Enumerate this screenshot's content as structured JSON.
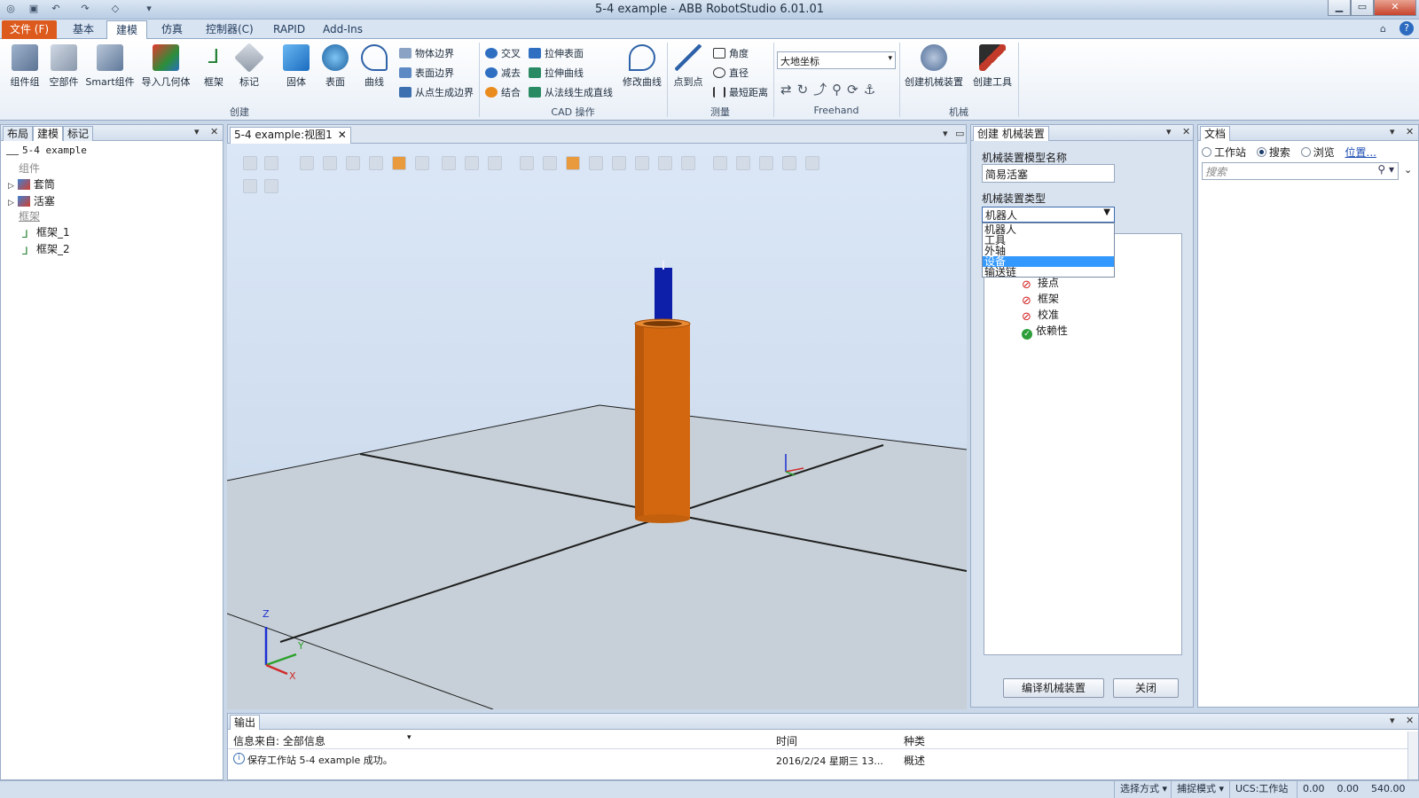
{
  "window": {
    "title": "5-4 example - ABB RobotStudio 6.01.01"
  },
  "menu_tabs": [
    "文件 (F)",
    "基本",
    "建模",
    "仿真",
    "控制器(C)",
    "RAPID",
    "Add-Ins"
  ],
  "ribbon": {
    "create_buttons": [
      "组件组",
      "空部件",
      "Smart组件",
      "导入几何体",
      "框架",
      "标记",
      "固体",
      "表面",
      "曲线"
    ],
    "border_items": [
      "物体边界",
      "表面边界",
      "从点生成边界"
    ],
    "group_create": "创建",
    "cad_items": [
      "交叉",
      "减去",
      "结合",
      "拉伸表面",
      "拉伸曲线",
      "从法线生成直线"
    ],
    "modify_curve": "修改曲线",
    "group_cad": "CAD 操作",
    "point_to_point": "点到点",
    "measure_items": [
      "角度",
      "直径",
      "最短距离"
    ],
    "group_measure": "测量",
    "coord_select": "大地坐标",
    "group_freehand": "Freehand",
    "mechanism_buttons": [
      "创建机械装置",
      "创建工具"
    ],
    "group_mechanism": "机械"
  },
  "left_panel": {
    "tabs": [
      "布局",
      "建模",
      "标记"
    ],
    "station": "5-4 example",
    "components_header": "组件",
    "components": [
      "套筒",
      "活塞"
    ],
    "frames_header": "框架",
    "frames": [
      "框架_1",
      "框架_2"
    ]
  },
  "view": {
    "tab": "5-4 example:视图1"
  },
  "mechanism_panel": {
    "title": "创建 机械装置",
    "name_label": "机械装置模型名称",
    "name_value": "简易活塞",
    "type_label": "机械装置类型",
    "type_selected": "机器人",
    "type_options": [
      "机器人",
      "工具",
      "外轴",
      "设备",
      "输送链"
    ],
    "highlighted_option": "设备",
    "tree_items": [
      "接点",
      "框架",
      "校准",
      "依赖性"
    ],
    "compile_button": "编译机械装置",
    "close_button": "关闭"
  },
  "doc_panel": {
    "title": "文档",
    "radios": [
      "工作站",
      "搜索",
      "浏览"
    ],
    "radio_selected": "搜索",
    "location_link": "位置...",
    "search_placeholder": "搜索"
  },
  "output": {
    "title": "输出",
    "filter_label": "信息来自: 全部信息",
    "col_time": "时间",
    "col_type": "种类",
    "rows": [
      {
        "message": "保存工作站 5-4 example 成功。",
        "time": "2016/2/24 星期三 13...",
        "type": "概述"
      }
    ]
  },
  "statusbar": {
    "select_mode": "选择方式 ▾",
    "snap_mode": "捕捉模式 ▾",
    "ucs": "UCS:工作站",
    "coords": "0.00    0.00    540.00"
  },
  "axes": {
    "z": "Z",
    "y": "Y",
    "x": "X"
  },
  "colors": {
    "file_tab": "#dd5a1d",
    "cylinder": "#d2670f",
    "piston": "#0d1fa8",
    "selection": "#3399ff"
  }
}
